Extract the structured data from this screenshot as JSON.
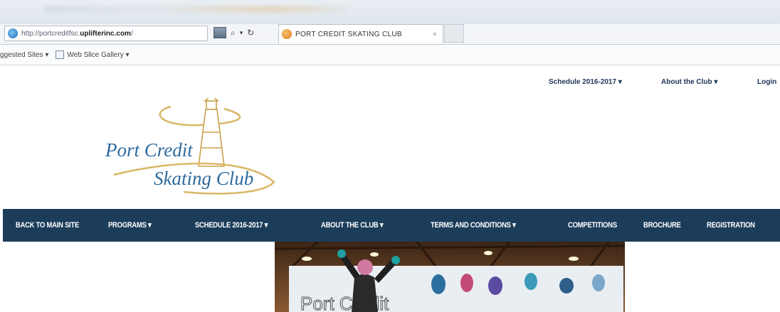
{
  "browser": {
    "address_prefix": "http://portcreditfsc.",
    "address_domain": "uplifterinc.com",
    "address_suffix": "/",
    "search_glyph": "⌕",
    "refresh_glyph": "↻",
    "tab_title": "PORT CREDIT SKATING CLUB",
    "tab_close": "×",
    "favorites": [
      {
        "label": "ggested Sites ▾"
      },
      {
        "label": "Web Slice Gallery ▾"
      }
    ]
  },
  "top_links": [
    {
      "label": "Schedule 2016-2017 ▾"
    },
    {
      "label": "About the Club ▾"
    },
    {
      "label": "Login"
    }
  ],
  "logo": {
    "line1": "Port Credit",
    "line2": "Skating Club",
    "colors": {
      "text": "#2f6a9e",
      "swoosh": "#d9b866"
    }
  },
  "nav": {
    "items": [
      {
        "label": "BACK TO MAIN SITE"
      },
      {
        "label": "PROGRAMS  ▾"
      },
      {
        "label": "SCHEDULE 2016-2017  ▾"
      },
      {
        "label": "ABOUT THE CLUB  ▾"
      },
      {
        "label": "TERMS AND CONDITIONS  ▾"
      },
      {
        "label": "COMPETITIONS"
      },
      {
        "label": "BROCHURE"
      },
      {
        "label": "REGISTRATION"
      }
    ],
    "background": "#1c3d5a"
  },
  "hero": {
    "banner_text": "Port Credit"
  }
}
